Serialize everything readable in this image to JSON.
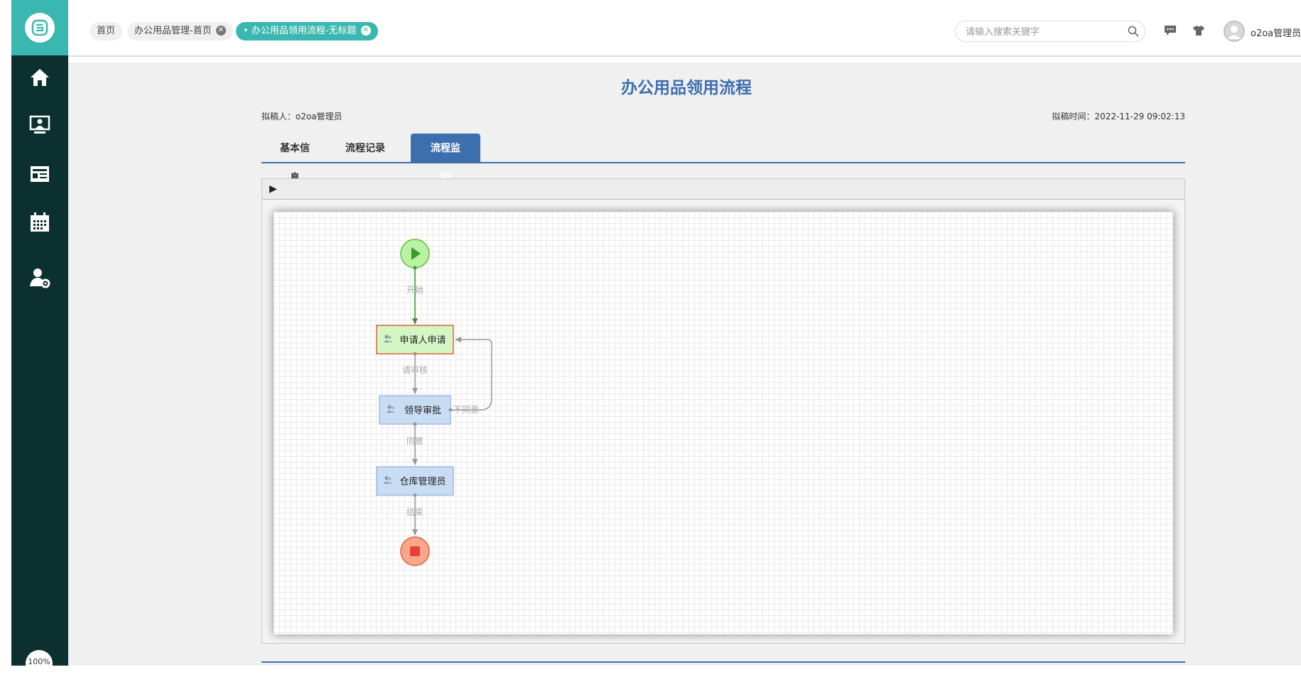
{
  "tabs": [
    {
      "label": "首页",
      "closable": false
    },
    {
      "label": "办公用品管理-首页",
      "closable": true
    },
    {
      "label": "办公用品领用流程-无标题",
      "closable": true,
      "active": true
    }
  ],
  "search": {
    "placeholder": "请输入搜索关键字"
  },
  "user": {
    "name": "o2oa管理员"
  },
  "sidebar": {
    "items": [
      {
        "icon": "home-icon"
      },
      {
        "icon": "monitor-user-icon"
      },
      {
        "icon": "news-icon"
      },
      {
        "icon": "calendar-icon"
      },
      {
        "icon": "user-settings-icon"
      }
    ],
    "zoom": "100%"
  },
  "form": {
    "title": "办公用品领用流程",
    "drafter": "拟稿人：o2oa管理员",
    "draft_time": "拟稿时间：2022-11-29 09:02:13",
    "tabs": [
      "基本信息",
      "流程记录",
      "流程监控"
    ],
    "active_tab": "流程监控"
  },
  "flow": {
    "nodes": {
      "apply": "申请人申请",
      "leader": "领导审批",
      "warehouse": "仓库管理员"
    },
    "routes": {
      "start": "开始",
      "review": "请审核",
      "disagree": "不同意",
      "agree": "同意",
      "end": "结束"
    }
  },
  "colors": {
    "brand_teal": "#3ab7b0",
    "sidebar_bg": "#0c2f30",
    "form_blue": "#3c6fae",
    "active_node_fill": "#d4f6c4",
    "active_node_border": "#e06040",
    "node_fill": "#c8dcf4",
    "start_green": "#b9f2a2",
    "end_red": "#f7a88a"
  }
}
